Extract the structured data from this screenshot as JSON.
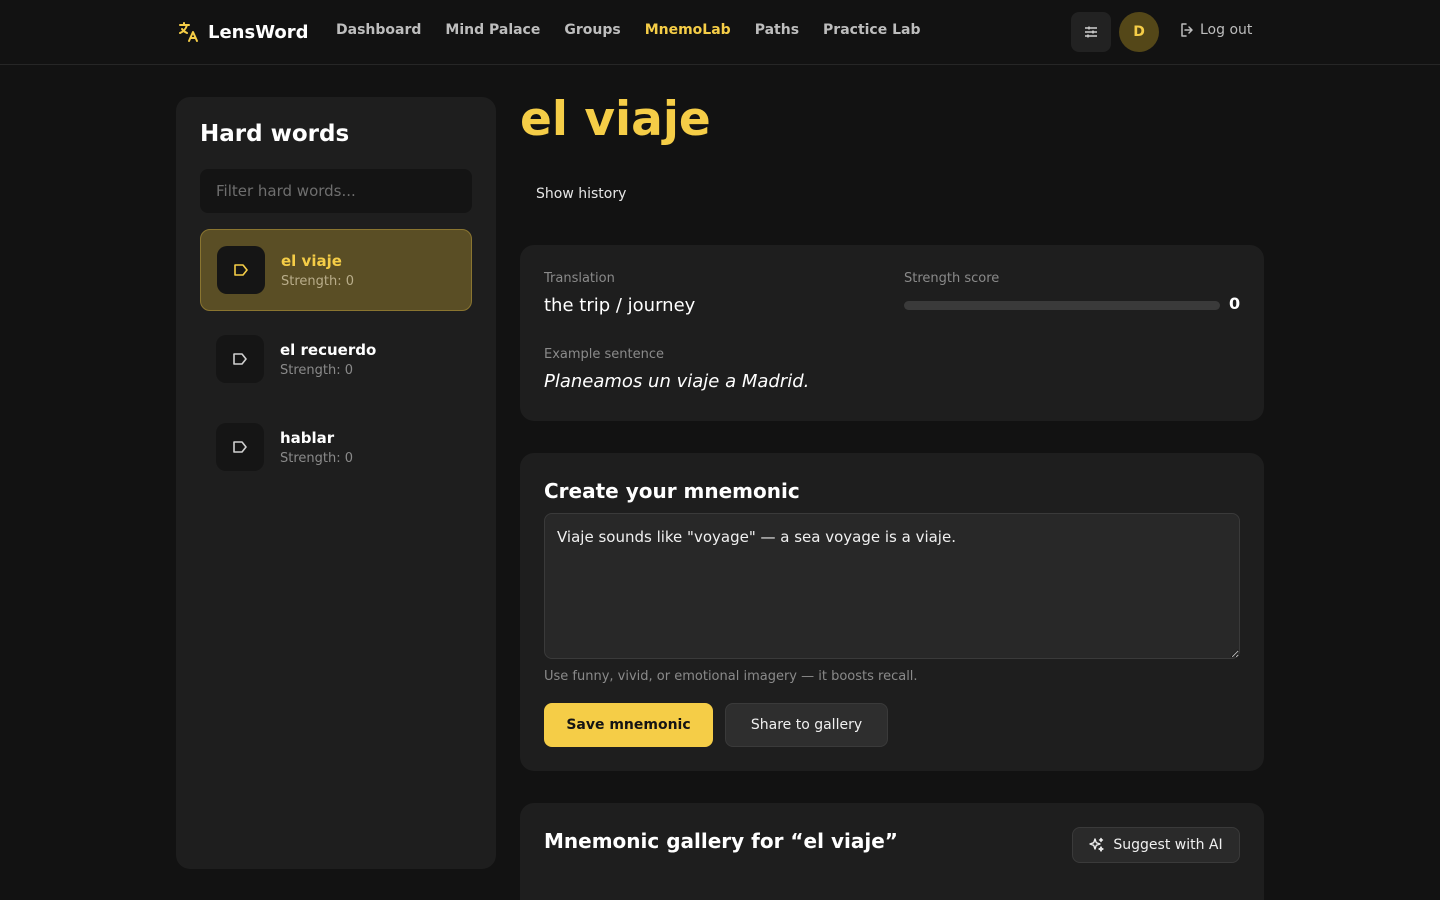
{
  "brand": {
    "name": "LensWord",
    "icon": "translate-icon"
  },
  "nav": {
    "items": [
      {
        "label": "Dashboard",
        "active": false
      },
      {
        "label": "Mind Palace",
        "active": false
      },
      {
        "label": "Groups",
        "active": false
      },
      {
        "label": "MnemoLab",
        "active": true
      },
      {
        "label": "Paths",
        "active": false
      },
      {
        "label": "Practice Lab",
        "active": false
      }
    ]
  },
  "header": {
    "avatar_initial": "D",
    "logout_label": "Log out"
  },
  "sidebar": {
    "title": "Hard words",
    "filter_placeholder": "Filter hard words...",
    "items": [
      {
        "word": "el viaje",
        "strength": "Strength: 0",
        "active": true
      },
      {
        "word": "el recuerdo",
        "strength": "Strength: 0",
        "active": false
      },
      {
        "word": "hablar",
        "strength": "Strength: 0",
        "active": false
      }
    ]
  },
  "main": {
    "title": "el viaje",
    "history_label": "Show history",
    "translation_label": "Translation",
    "translation": "the trip / journey",
    "strength_label": "Strength score",
    "strength_value": "0",
    "strength_fraction": 0,
    "example_label": "Example sentence",
    "example": "Planeamos un viaje a Madrid."
  },
  "mnemonic": {
    "title": "Create your mnemonic",
    "text": "Viaje sounds like \"voyage\" — a sea voyage is a viaje.",
    "hint": "Use funny, vivid, or emotional imagery — it boosts recall.",
    "save_label": "Save mnemonic",
    "share_label": "Share to gallery"
  },
  "gallery": {
    "title": "Mnemonic gallery for “el viaje”",
    "suggest_label": "Suggest with AI"
  },
  "colors": {
    "accent": "#f5cd47",
    "background": "#121212",
    "card": "#1e1e1e"
  }
}
